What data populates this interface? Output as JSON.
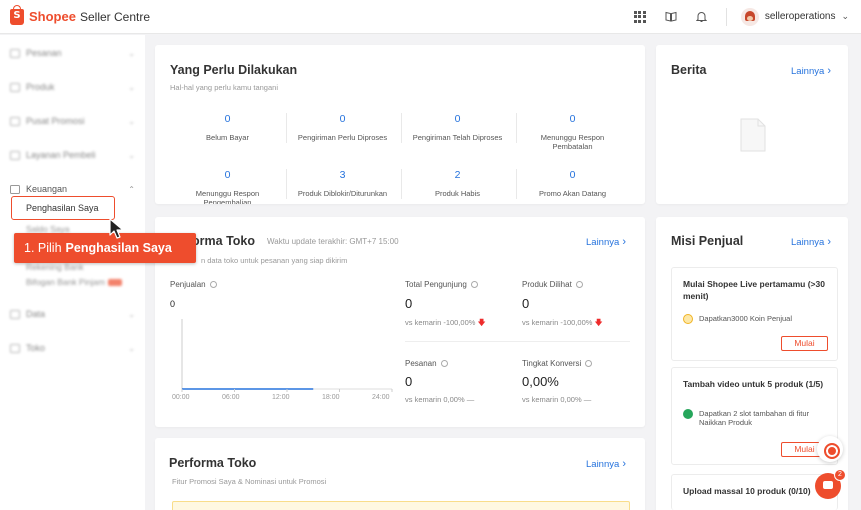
{
  "header": {
    "brand": "Shopee",
    "product": "Seller Centre",
    "username": "selleroperations",
    "icons": [
      "apps-grid-icon",
      "book-icon",
      "bell-icon",
      "avatar"
    ]
  },
  "sidebar": {
    "groups": [
      {
        "label": "Pesanan",
        "blurred": true
      },
      {
        "label": "Produk",
        "blurred": true
      },
      {
        "label": "Pusat Promosi",
        "blurred": true
      },
      {
        "label": "Layanan Pembeli",
        "blurred": true
      },
      {
        "label": "Keuangan",
        "blurred": false
      },
      {
        "label": "Data",
        "blurred": true
      },
      {
        "label": "Toko",
        "blurred": true
      }
    ],
    "active_item": "Penghasilan Saya",
    "sub_items": [
      "Saldo Saya",
      "Rekening Bank",
      "Bifogan Bank Pinjam"
    ]
  },
  "callout": {
    "prefix": "1. Pilih",
    "bold": "Penghasilan Saya"
  },
  "todo": {
    "title": "Yang Perlu Dilakukan",
    "subtitle": "Hal-hal yang perlu kamu tangani",
    "items": [
      {
        "value": "0",
        "label": "Belum Bayar"
      },
      {
        "value": "0",
        "label": "Pengiriman Perlu Diproses"
      },
      {
        "value": "0",
        "label": "Pengiriman Telah Diproses"
      },
      {
        "value": "0",
        "label": "Menunggu Respon Pembatalan"
      },
      {
        "value": "0",
        "label": "Menunggu Respon Pengembalian"
      },
      {
        "value": "3",
        "label": "Produk Diblokir/Diturunkan"
      },
      {
        "value": "2",
        "label": "Produk Habis"
      },
      {
        "value": "0",
        "label": "Promo Akan Datang"
      }
    ]
  },
  "performa": {
    "title_visible": "rforma Toko",
    "update": "Waktu update terakhir: GMT+7 15:00",
    "subtitle_visible": "n data toko untuk pesanan yang siap dikirim",
    "more": "Lainnya",
    "chart_label": "Penjualan",
    "chart_value": "0",
    "metrics": [
      {
        "label": "Total Pengunjung",
        "value": "0",
        "compare": "vs kemarin -100,00%",
        "trend": "down"
      },
      {
        "label": "Produk Dilihat",
        "value": "0",
        "compare": "vs kemarin -100,00%",
        "trend": "down"
      },
      {
        "label": "Pesanan",
        "value": "0",
        "compare": "vs kemarin 0,00% —",
        "trend": "flat"
      },
      {
        "label": "Tingkat Konversi",
        "value": "0,00%",
        "compare": "vs kemarin 0,00% —",
        "trend": "flat"
      }
    ]
  },
  "chart_data": {
    "type": "line",
    "x": [
      "00:00",
      "06:00",
      "12:00",
      "18:00",
      "24:00"
    ],
    "series": [
      {
        "values": [
          0,
          0,
          0,
          0,
          0
        ]
      }
    ],
    "ylabel": "Penjualan",
    "xlabel": ""
  },
  "performa2": {
    "title": "Performa Toko",
    "subtitle": "Fitur Promosi Saya & Nominasi untuk Promosi",
    "more": "Lainnya"
  },
  "berita": {
    "title": "Berita",
    "more": "Lainnya"
  },
  "misi": {
    "title": "Misi Penjual",
    "more": "Lainnya",
    "missions": [
      {
        "title": "Mulai Shopee Live pertamamu (>30 menit)",
        "reward": "Dapatkan3000 Koin Penjual",
        "button": "Mulai",
        "reward_icon": "coin-icon"
      },
      {
        "title": "Tambah video untuk 5 produk (1/5)",
        "reward": "Dapatkan 2 slot tambahan di fitur Naikkan Produk",
        "button": "Mulai",
        "reward_icon": "bolt-icon"
      },
      {
        "title": "Upload massal 10 produk (0/10)",
        "reward": "",
        "button": "",
        "reward_icon": ""
      }
    ]
  },
  "floating": {
    "chat_count": "2"
  },
  "colors": {
    "brand": "#ee4d2d",
    "link": "#2673dd",
    "background": "#f3f3f5"
  }
}
